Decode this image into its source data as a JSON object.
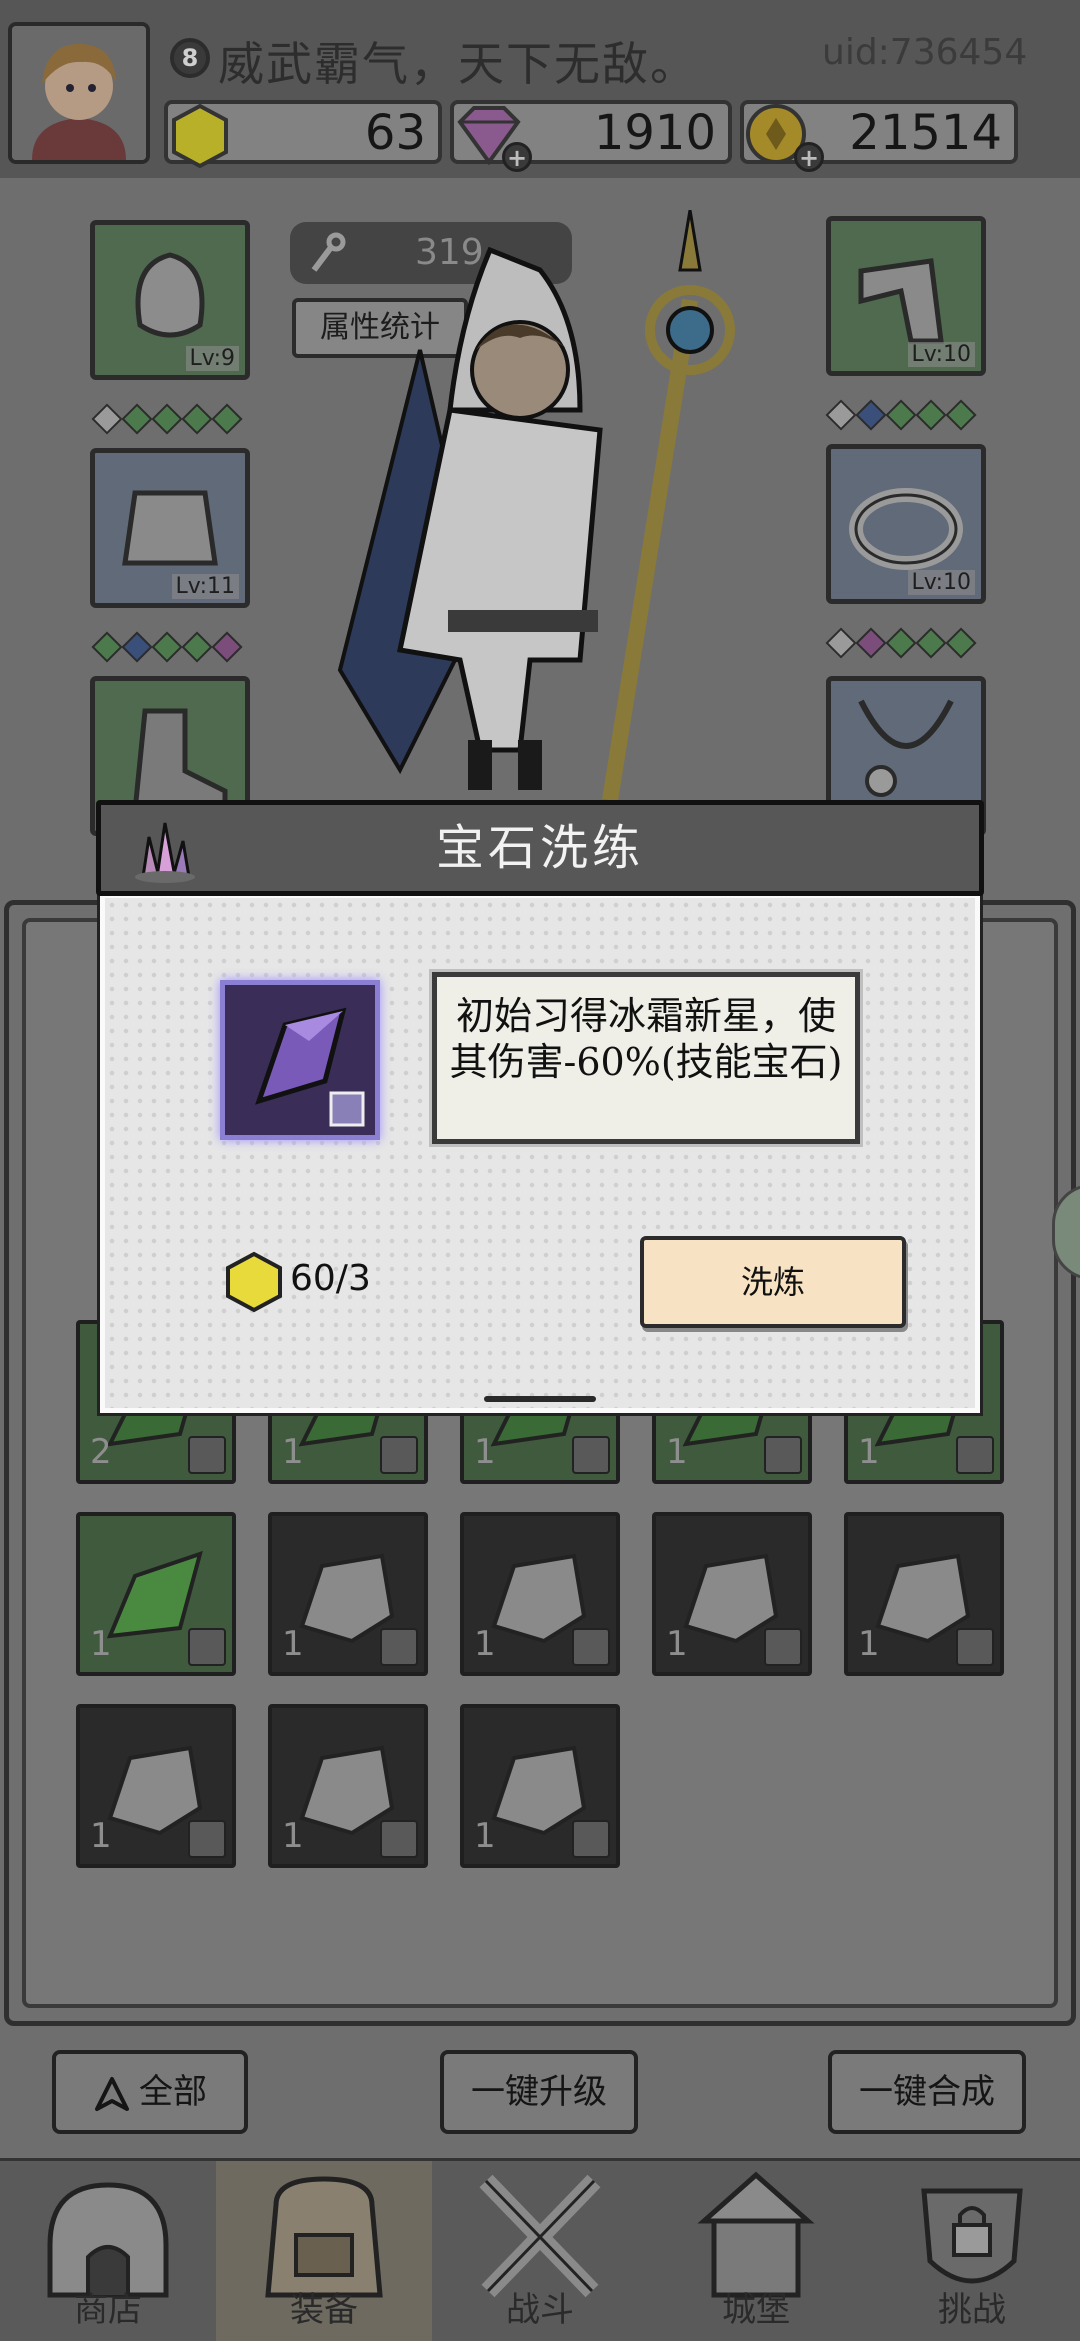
{
  "header": {
    "level": "8",
    "motto": "威武霸气，天下无敌。",
    "uid": "uid:736454",
    "currencies": [
      {
        "name": "gold-hexagon",
        "value": "63"
      },
      {
        "name": "purple-diamond",
        "value": "1910"
      },
      {
        "name": "gold-coin",
        "value": "21514"
      }
    ]
  },
  "character": {
    "power": "319",
    "attr_stats_label": "属性统计",
    "slots": {
      "helmet_lv": "Lv:9",
      "armor_lv": "Lv:11",
      "weapon_lv": "Lv:10",
      "ring_lv": "Lv:10"
    }
  },
  "modal": {
    "title": "宝石洗练",
    "description": "初始习得冰霜新星，使其伤害-60%(技能宝石)",
    "cost": "60/3",
    "refine_label": "洗炼"
  },
  "inventory": {
    "row_partial": [
      "2",
      "1",
      "1",
      "1",
      "1"
    ],
    "row2": [
      "1",
      "1",
      "1",
      "1",
      "1"
    ],
    "row3": [
      "1",
      "1",
      "1"
    ]
  },
  "actions": {
    "all_label": "全部",
    "upgrade_all_label": "一键升级",
    "merge_all_label": "一键合成"
  },
  "tabs": [
    {
      "label": "商店",
      "icon": "shop-icon"
    },
    {
      "label": "装备",
      "icon": "backpack-icon"
    },
    {
      "label": "战斗",
      "icon": "crossed-swords-icon"
    },
    {
      "label": "城堡",
      "icon": "castle-icon"
    },
    {
      "label": "挑战",
      "icon": "locked-shield-icon"
    }
  ],
  "colors": {
    "modal_title_bg": "#575757",
    "refine_button": "#f7e3c4",
    "gem_glow": "#9d91ff",
    "green_slot": "#4f6a4e"
  }
}
